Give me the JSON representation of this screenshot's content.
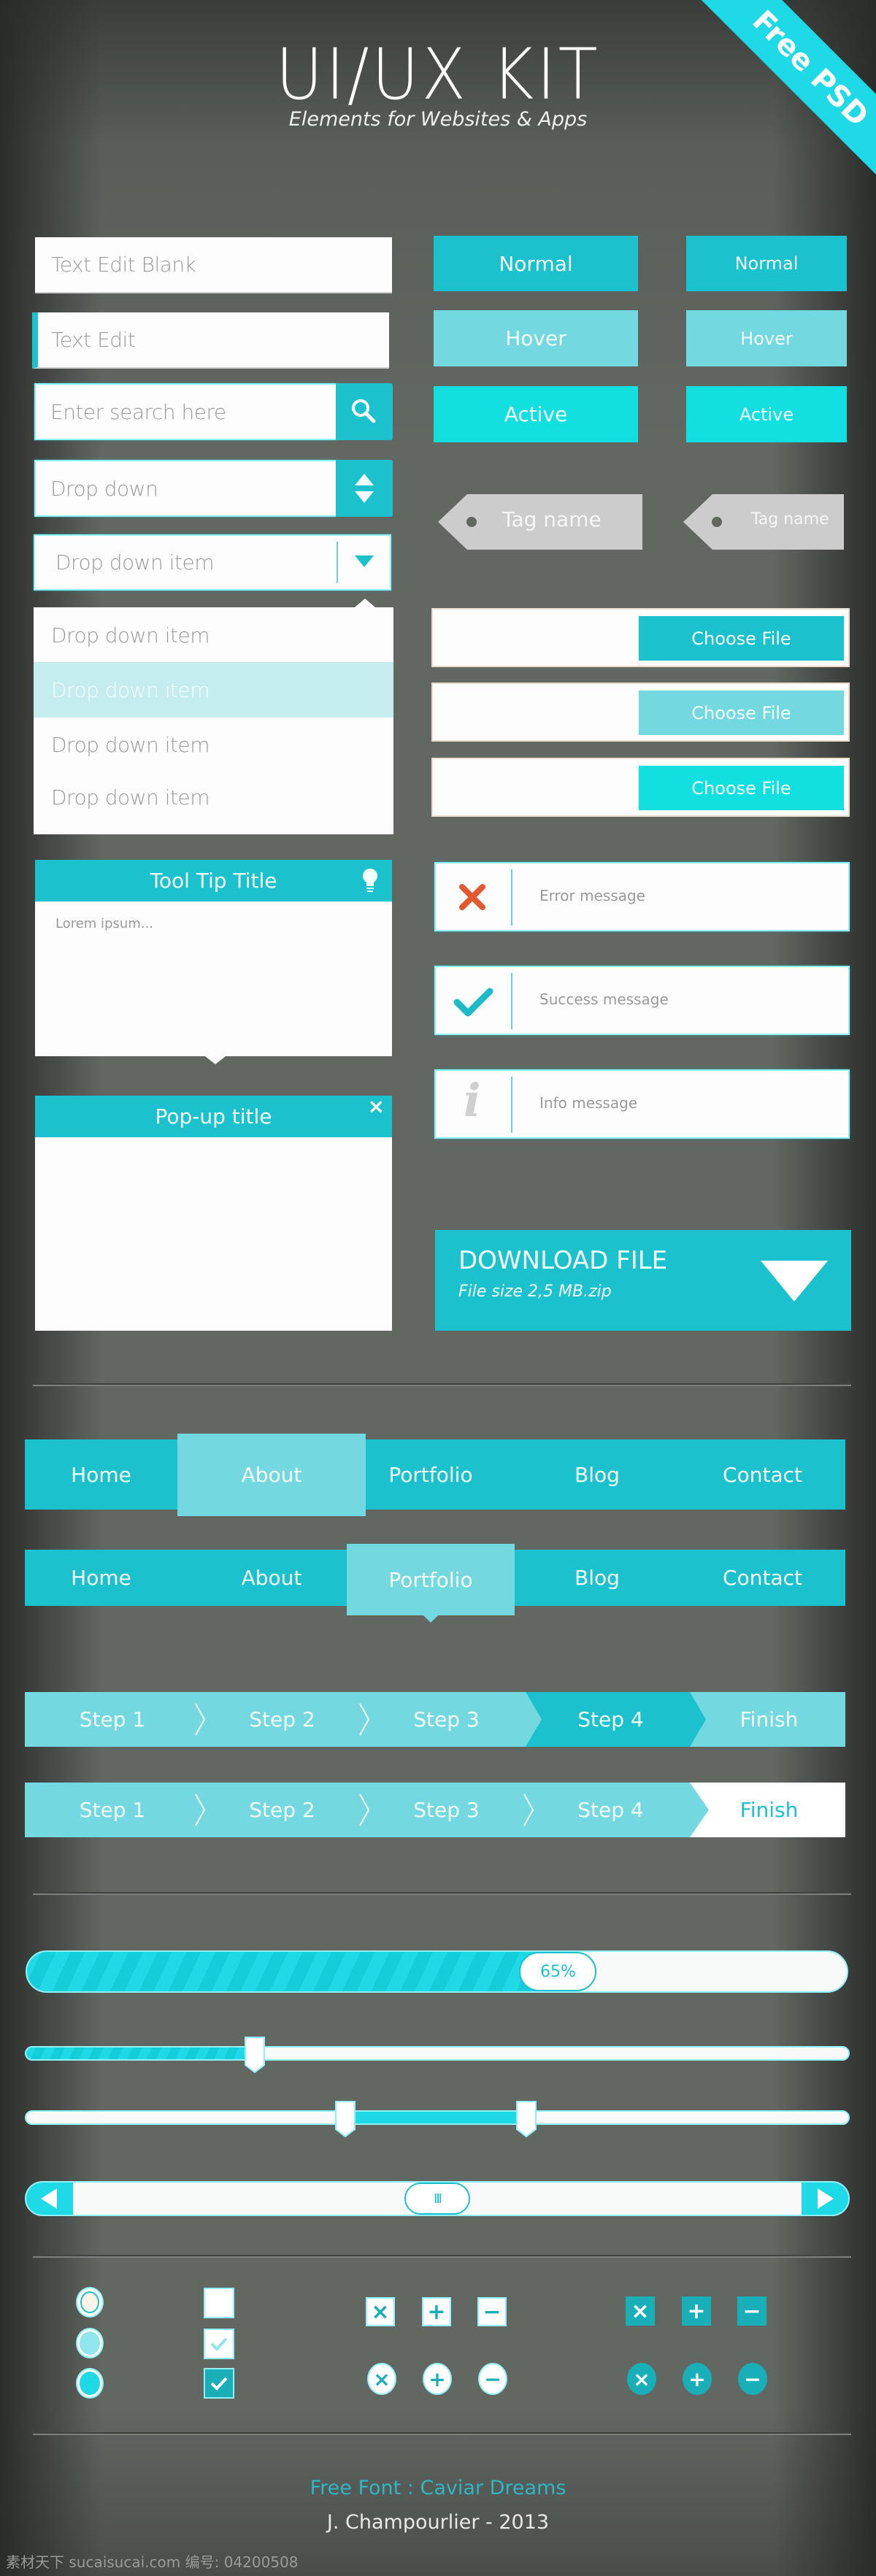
{
  "header": {
    "title": "UI/UX KIT",
    "subtitle": "Elements for Websites & Apps",
    "ribbon": "Free PSD"
  },
  "colors": {
    "normal": "#1cc1ce",
    "hover": "#74d8e0",
    "active": "#12e0e0",
    "error": "#e4582f",
    "tag": "#cccccc"
  },
  "inputs": {
    "text_blank": "Text Edit Blank",
    "text_edit": "Text Edit",
    "search_placeholder": "Enter search here",
    "dropdown": "Drop down",
    "dropdown_select": "Drop down item",
    "dropdown_items": [
      "Drop down item",
      "Drop down item",
      "Drop down item",
      "Drop down item"
    ],
    "dropdown_highlighted_index": 1
  },
  "buttons": {
    "large": [
      "Normal",
      "Hover",
      "Active"
    ],
    "small": [
      "Normal",
      "Hover",
      "Active"
    ]
  },
  "tags": [
    "Tag name",
    "Tag name"
  ],
  "file_inputs": [
    "Choose File",
    "Choose File",
    "Choose File"
  ],
  "tooltip": {
    "title": "Tool Tip Title",
    "body": "Lorem ipsum..."
  },
  "popup": {
    "title": "Pop-up title",
    "close": "×"
  },
  "messages": [
    {
      "type": "error",
      "icon": "error-x-icon",
      "text": "Error message"
    },
    {
      "type": "success",
      "icon": "check-icon",
      "text": "Success message"
    },
    {
      "type": "info",
      "icon": "info-icon",
      "text": "Info message"
    }
  ],
  "download": {
    "title": "DOWNLOAD FILE",
    "subtitle": "File size 2,5 MB.zip"
  },
  "navs": [
    {
      "items": [
        "Home",
        "About",
        "Portfolio",
        "Blog",
        "Contact"
      ],
      "active_index": 1
    },
    {
      "items": [
        "Home",
        "About",
        "Portfolio",
        "Blog",
        "Contact"
      ],
      "active_index": 2
    }
  ],
  "steps": [
    {
      "items": [
        "Step 1",
        "Step 2",
        "Step 3",
        "Step 4",
        "Finish"
      ],
      "active_index": 3
    },
    {
      "items": [
        "Step 1",
        "Step 2",
        "Step 3",
        "Step 4",
        "Finish"
      ],
      "active_index": 4
    }
  ],
  "progress": {
    "value": 0.65,
    "label": "65%"
  },
  "slider": {
    "value": 0.28
  },
  "range_slider": {
    "low": 0.39,
    "high": 0.61
  },
  "scrollbar": {
    "position": 0.5,
    "thumb_label": "III"
  },
  "radios": [
    {
      "state": "unselected"
    },
    {
      "state": "hover"
    },
    {
      "state": "selected"
    }
  ],
  "checkboxes": [
    {
      "state": "unchecked"
    },
    {
      "state": "hover-checked"
    },
    {
      "state": "checked"
    }
  ],
  "icon_buttons": {
    "glyphs": [
      "×",
      "+",
      "−"
    ],
    "names": [
      "close-icon",
      "plus-icon",
      "minus-icon"
    ]
  },
  "footer": {
    "font_credit": "Free Font : Caviar Dreams",
    "author": "J. Champourlier - 2013",
    "watermark": "素材天下 sucaisucai.com  编号: 04200508"
  }
}
